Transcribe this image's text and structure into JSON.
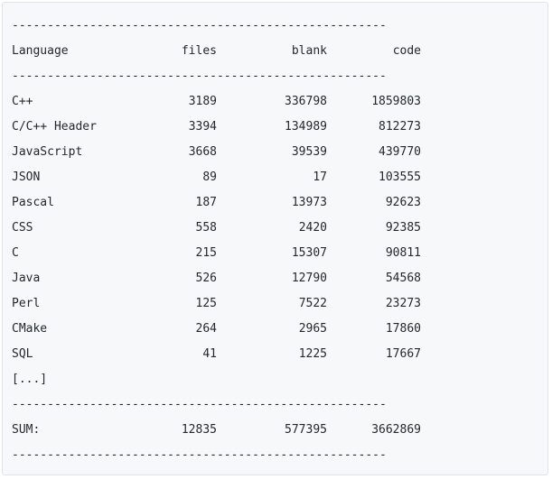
{
  "rule": "-----------------------------------------------------",
  "header": {
    "language": "Language",
    "files": "files",
    "blank": "blank",
    "code": "code"
  },
  "rows": [
    {
      "language": "C++",
      "files": "3189",
      "blank": "336798",
      "code": "1859803"
    },
    {
      "language": "C/C++ Header",
      "files": "3394",
      "blank": "134989",
      "code": "812273"
    },
    {
      "language": "JavaScript",
      "files": "3668",
      "blank": "39539",
      "code": "439770"
    },
    {
      "language": "JSON",
      "files": "89",
      "blank": "17",
      "code": "103555"
    },
    {
      "language": "Pascal",
      "files": "187",
      "blank": "13973",
      "code": "92623"
    },
    {
      "language": "CSS",
      "files": "558",
      "blank": "2420",
      "code": "92385"
    },
    {
      "language": "C",
      "files": "215",
      "blank": "15307",
      "code": "90811"
    },
    {
      "language": "Java",
      "files": "526",
      "blank": "12790",
      "code": "54568"
    },
    {
      "language": "Perl",
      "files": "125",
      "blank": "7522",
      "code": "23273"
    },
    {
      "language": "CMake",
      "files": "264",
      "blank": "2965",
      "code": "17860"
    },
    {
      "language": "SQL",
      "files": "41",
      "blank": "1225",
      "code": "17667"
    }
  ],
  "ellipsis": "[...]",
  "sum": {
    "label": "SUM:",
    "files": "12835",
    "blank": "577395",
    "code": "3662869"
  }
}
